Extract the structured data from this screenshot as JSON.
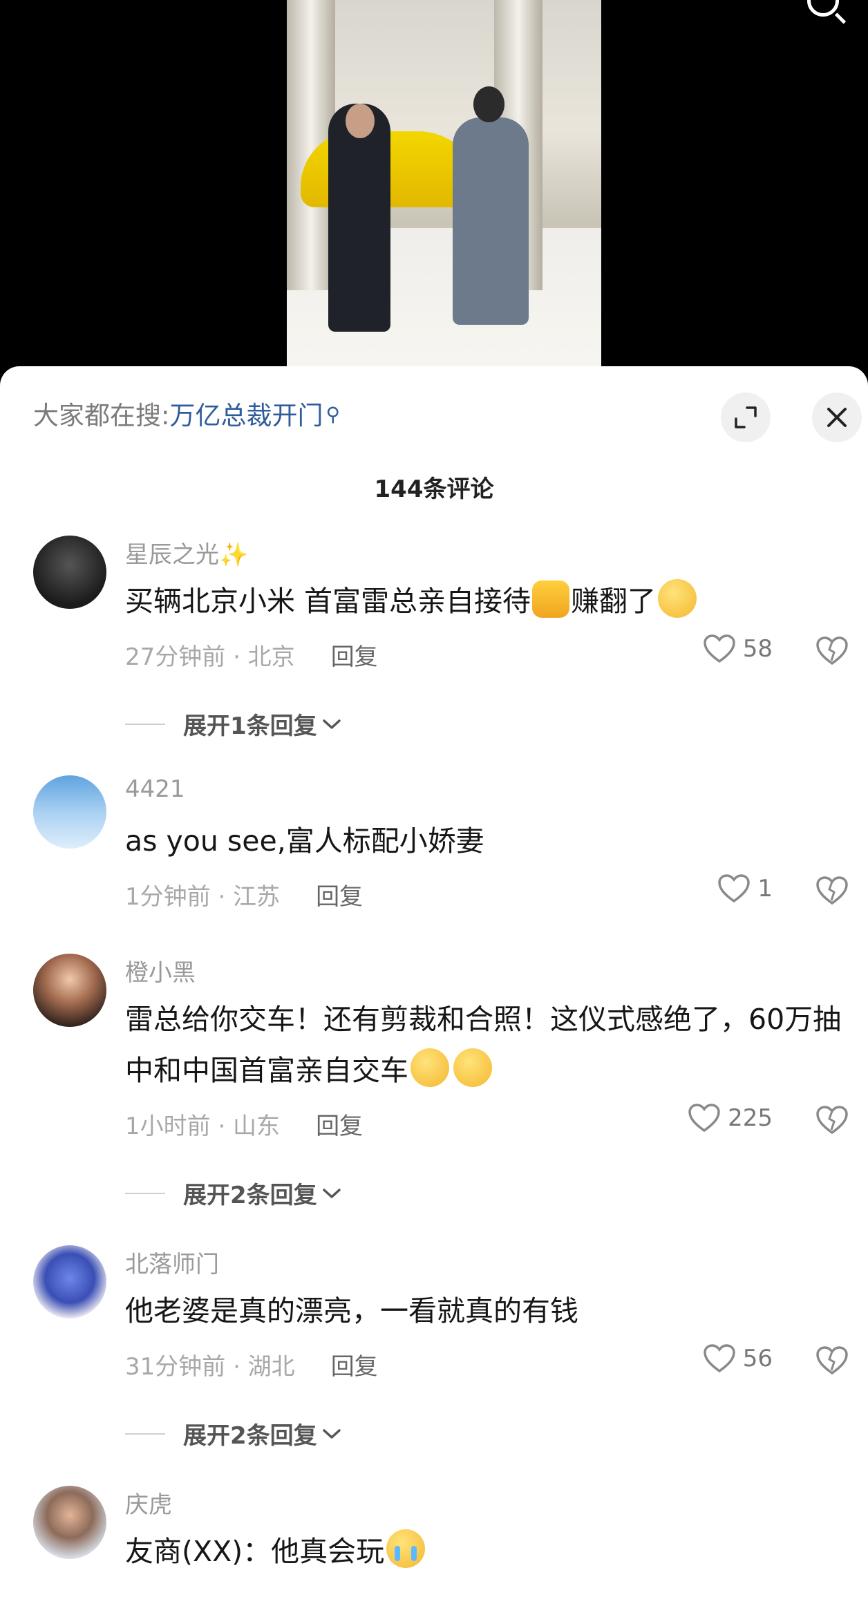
{
  "search": {
    "prefix": "大家都在搜:",
    "term": "万亿总裁开门",
    "glyph": "⚲"
  },
  "comment_count": "144条评论",
  "comments": [
    {
      "username": "星辰之光",
      "username_emoji": "✨",
      "text": "买辆北京小米 首富雷总亲自接待",
      "text_after_emoji": "赚翻了",
      "time_location": "27分钟前 · 北京",
      "reply_label": "回复",
      "likes": "58",
      "expand_label": "展开1条回复"
    },
    {
      "username": "4421",
      "text": "as you see,富人标配小娇妻",
      "time_location": "1分钟前 · 江苏",
      "reply_label": "回复",
      "likes": "1"
    },
    {
      "username": "橙小黑",
      "text": "雷总给你交车！还有剪裁和合照！这仪式感绝了，60万抽中和中国首富亲自交车",
      "time_location": "1小时前 · 山东",
      "reply_label": "回复",
      "likes": "225",
      "expand_label": "展开2条回复"
    },
    {
      "username": "北落师门",
      "text": "他老婆是真的漂亮，一看就真的有钱",
      "time_location": "31分钟前 · 湖北",
      "reply_label": "回复",
      "likes": "56",
      "expand_label": "展开2条回复"
    },
    {
      "username": "庆虎",
      "text": "友商(XX)：他真会玩"
    }
  ],
  "colors": {
    "accent_link": "#2f5d9c",
    "meta_gray": "#a8a8a8",
    "text_primary": "#161616"
  }
}
